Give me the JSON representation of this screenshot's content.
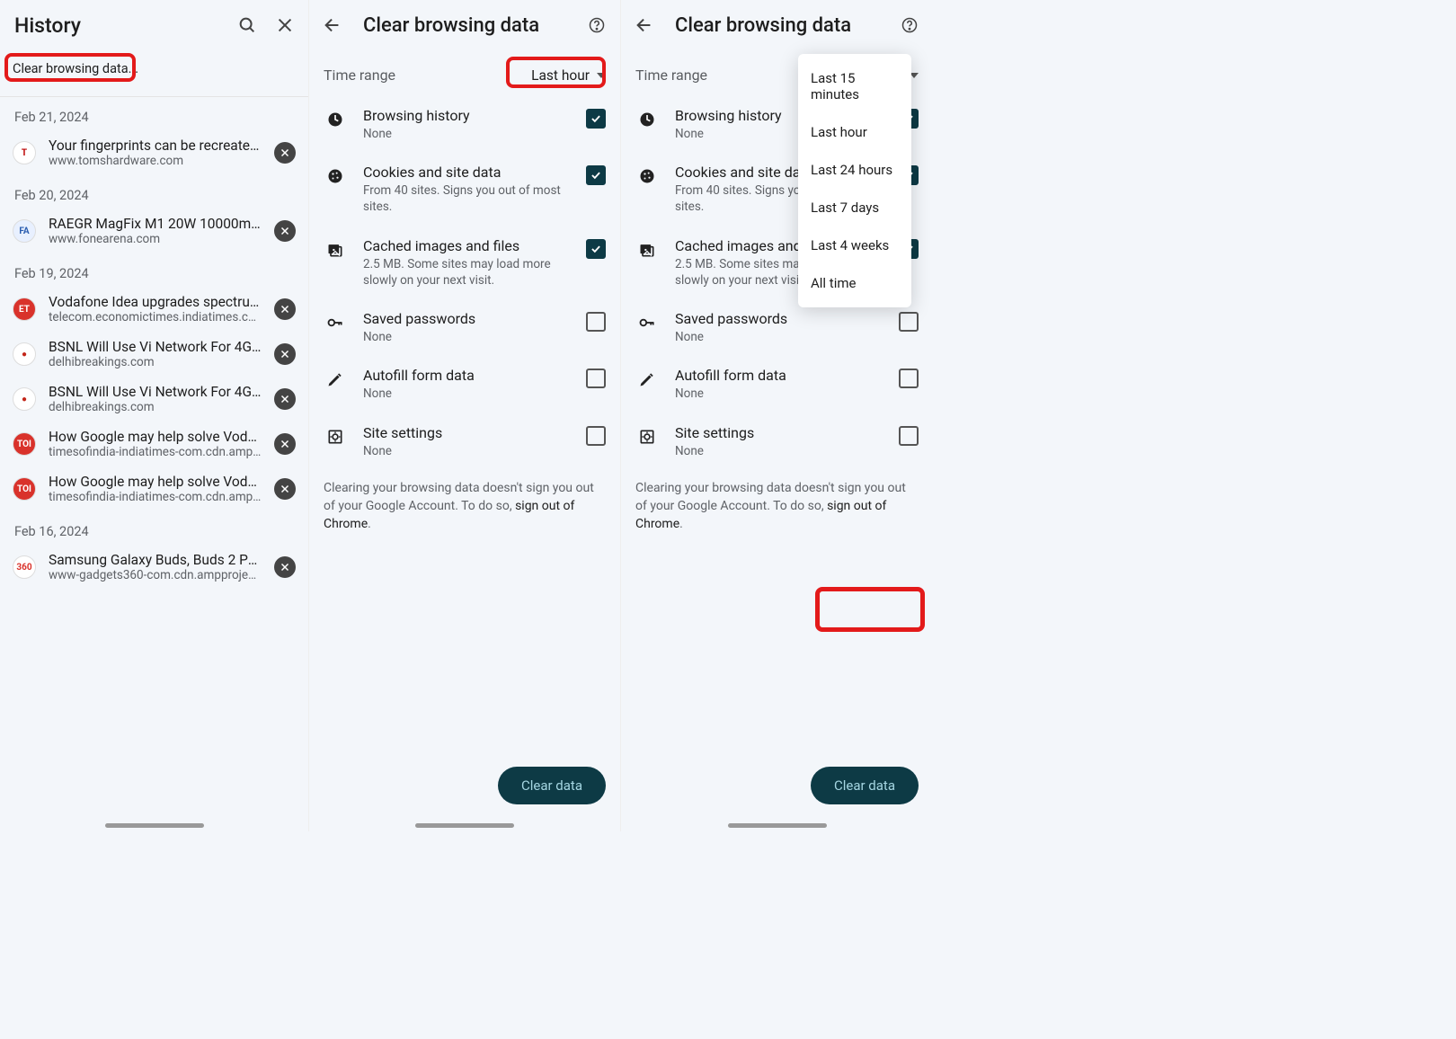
{
  "highlights": {
    "rb2_pos": "dropdown",
    "rb3_pos": "button"
  },
  "history": {
    "title": "History",
    "clear_link": "Clear browsing data...",
    "groups": [
      {
        "date": "Feb 21, 2024",
        "items": [
          {
            "title": "Your fingerprints can be recreated f…",
            "url": "www.tomshardware.com",
            "fav": "T",
            "favbg": "#fff",
            "favclr": "#b00"
          }
        ]
      },
      {
        "date": "Feb 20, 2024",
        "items": [
          {
            "title": "RAEGR MagFix M1 20W 10000mAh…",
            "url": "www.fonearena.com",
            "fav": "FA",
            "favbg": "#e8f0ff",
            "favclr": "#2a5db0"
          }
        ]
      },
      {
        "date": "Feb 19, 2024",
        "items": [
          {
            "title": "Vodafone Idea upgrades spectrum …",
            "url": "telecom.economictimes.indiatimes.com",
            "fav": "ET",
            "favbg": "#d9322b",
            "favclr": "#fff"
          },
          {
            "title": "BSNL Will Use Vi Network For 4G a…",
            "url": "delhibreakings.com",
            "fav": "●",
            "favbg": "#fff",
            "favclr": "#c3261a"
          },
          {
            "title": "BSNL Will Use Vi Network For 4G a…",
            "url": "delhibreakings.com",
            "fav": "●",
            "favbg": "#fff",
            "favclr": "#c3261a"
          },
          {
            "title": "How Google may help solve Vodafo…",
            "url": "timesofindia-indiatimes-com.cdn.ampproj…",
            "fav": "TOI",
            "favbg": "#d9322b",
            "favclr": "#fff"
          },
          {
            "title": "How Google may help solve Vodafo…",
            "url": "timesofindia-indiatimes-com.cdn.ampproj…",
            "fav": "TOI",
            "favbg": "#d9322b",
            "favclr": "#fff"
          }
        ]
      },
      {
        "date": "Feb 16, 2024",
        "items": [
          {
            "title": "Samsung Galaxy Buds, Buds 2 Pro, …",
            "url": "www-gadgets360-com.cdn.ampproject.org",
            "fav": "360",
            "favbg": "#fff",
            "favclr": "#d9322b"
          }
        ]
      }
    ]
  },
  "cbd": {
    "title": "Clear browsing data",
    "time_label": "Time range",
    "time_selected": "Last hour",
    "options": [
      {
        "icon": "clock",
        "title": "Browsing history",
        "sub": "None",
        "checked": true
      },
      {
        "icon": "cookie",
        "title": "Cookies and site data",
        "sub": "From 40 sites. Signs you out of most sites.",
        "checked": true
      },
      {
        "icon": "image",
        "title": "Cached images and files",
        "sub": "2.5 MB. Some sites may load more slowly on your next visit.",
        "checked": true
      },
      {
        "icon": "key",
        "title": "Saved passwords",
        "sub": "None",
        "checked": false
      },
      {
        "icon": "pen",
        "title": "Autofill form data",
        "sub": "None",
        "checked": false
      },
      {
        "icon": "gear",
        "title": "Site settings",
        "sub": "None",
        "checked": false
      }
    ],
    "foot1": "Clearing your browsing data doesn't sign you out of your Google Account. To do so, ",
    "foot_link": "sign out of Chrome",
    "button": "Clear data"
  },
  "menu": {
    "items": [
      "Last 15 minutes",
      "Last hour",
      "Last 24 hours",
      "Last 7 days",
      "Last 4 weeks",
      "All time"
    ]
  }
}
